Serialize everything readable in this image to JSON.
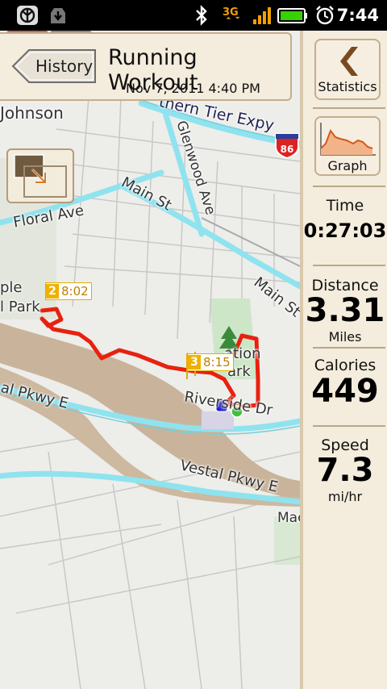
{
  "status_bar": {
    "time": "7:44",
    "icons": [
      "app-logo-icon",
      "download-icon",
      "bluetooth-icon",
      "3g-icon",
      "signal-icon",
      "battery-icon",
      "alarm-icon"
    ]
  },
  "header": {
    "back_label": "History",
    "title": "Running Workout",
    "date": "Nov 7, 2011 4:40 PM"
  },
  "map": {
    "labels": {
      "johnson": "Johnson",
      "expy": "thern Tier Expy",
      "glenwood": "Glenwood Ave",
      "main_st_1": "Main St",
      "main_st_2": "Main St",
      "floral": "Floral Ave",
      "park_a": "ple",
      "park_b": "l Park",
      "ation": "ation",
      "ark": "ark",
      "riverside": "Riverside Dr",
      "vestal_1": "al Pkwy E",
      "vestal_2": "Vestal Pkwy E",
      "mac": "Mac",
      "highway_number": "86"
    },
    "waypoints": [
      {
        "num": "2",
        "time": "8:02"
      },
      {
        "num": "3",
        "time": "8:15"
      }
    ],
    "route_color": "#e8210f"
  },
  "sidebar": {
    "statistics_label": "Statistics",
    "graph_label": "Graph",
    "time_label": "Time",
    "time_value": "0:27:03",
    "distance_label": "Distance",
    "distance_value": "3.31",
    "distance_unit": "Miles",
    "calories_label": "Calories",
    "calories_value": "449",
    "speed_label": "Speed",
    "speed_value": "7.3",
    "speed_unit": "mi/hr"
  },
  "social": [
    "facebook-icon",
    "twitter-icon"
  ],
  "colors": {
    "panel_bg": "#f4ecdc",
    "road_highlight": "#8fe3ee",
    "river": "#c9b49b",
    "route": "#e8210f"
  }
}
